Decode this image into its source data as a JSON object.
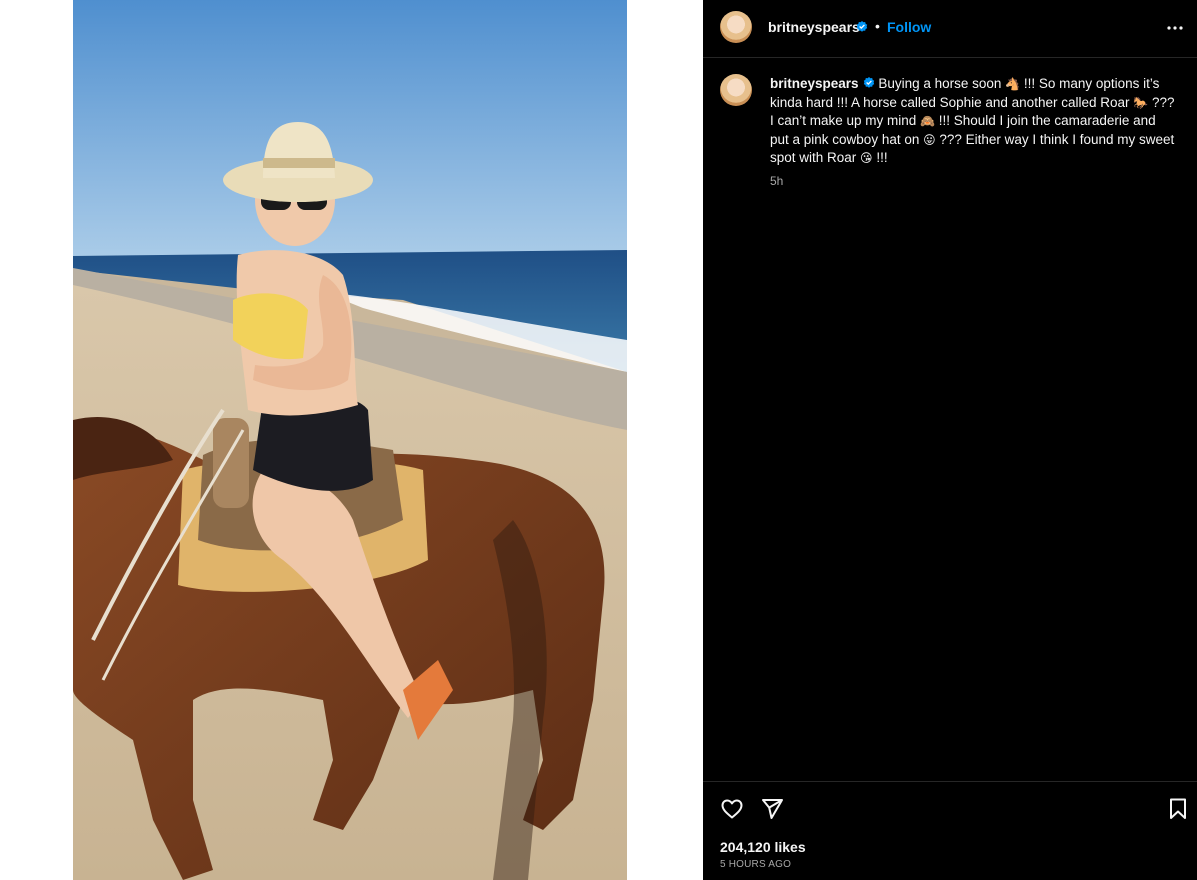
{
  "post": {
    "username": "britneyspears",
    "separator": "•",
    "follow_label": "Follow",
    "caption": {
      "part1": "Buying a horse soon ",
      "emoji1": "🐴",
      "part2": " !!! So many options it’s kinda hard !!! A horse called Sophie and another called Roar ",
      "emoji2": "🐎",
      "part3": " ??? I can’t make up my mind ",
      "emoji3": "🙈",
      "part4": " !!! Should I join the camaraderie and put a pink cowboy hat on ",
      "emoji4": "😛",
      "part5": " ??? Either way I think I found my sweet spot with Roar ",
      "emoji5": "😘",
      "part6": " !!!"
    },
    "comment_time": "5h",
    "likes": "204,120 likes",
    "posted_ago": "5 HOURS AGO"
  },
  "icons": {
    "verified": "verified-badge-icon",
    "more": "more-options-icon",
    "like": "heart-icon",
    "share": "paper-plane-icon",
    "save": "bookmark-icon"
  },
  "colors": {
    "follow": "#0095f6",
    "verified": "#0095f6",
    "panel_bg": "#000000",
    "muted_text": "#a8a8a8"
  }
}
